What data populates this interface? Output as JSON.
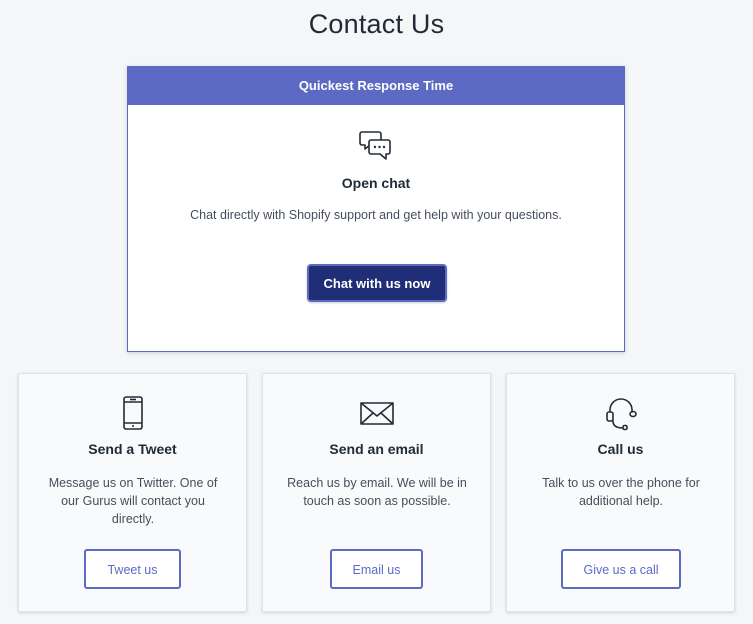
{
  "page": {
    "title": "Contact Us"
  },
  "featured": {
    "header": "Quickest Response Time",
    "icon": "chat-bubbles-icon",
    "title": "Open chat",
    "description": "Chat directly with Shopify support and get help with your questions.",
    "button_label": "Chat with us now"
  },
  "cards": [
    {
      "icon": "mobile-phone-icon",
      "title": "Send a Tweet",
      "description": "Message us on Twitter. One of our Gurus will contact you directly.",
      "button_label": "Tweet us"
    },
    {
      "icon": "envelope-icon",
      "title": "Send an email",
      "description": "Reach us by email. We will be in touch as soon as possible.",
      "button_label": "Email us"
    },
    {
      "icon": "headset-icon",
      "title": "Call us",
      "description": "Talk to us over the phone for additional help.",
      "button_label": "Give us a call"
    }
  ],
  "colors": {
    "accent": "#5c6ac4",
    "primary_button": "#202e78",
    "background": "#f5f6f8",
    "text": "#212b36"
  }
}
